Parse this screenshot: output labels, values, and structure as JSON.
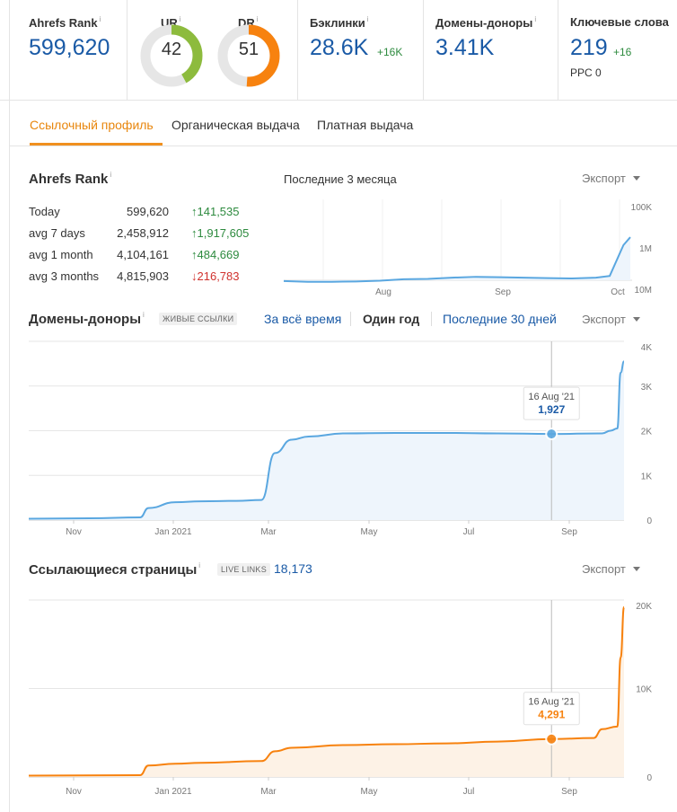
{
  "metrics": {
    "ahrefs_rank": {
      "label": "Ahrefs Rank",
      "value": "599,620"
    },
    "ur": {
      "label": "UR",
      "value": "42",
      "score": 42,
      "color": "#8dbb3d"
    },
    "dr": {
      "label": "DR",
      "value": "51",
      "score": 51,
      "color": "#f7820f"
    },
    "backlinks": {
      "label": "Бэклинки",
      "value": "28.6K",
      "delta": "+16K"
    },
    "ref_domains": {
      "label": "Домены-доноры",
      "value": "3.41K"
    },
    "keywords": {
      "label": "Ключевые слова",
      "value": "219",
      "delta": "+16",
      "sub": "PPC 0"
    }
  },
  "info_mark": "i",
  "tabs": [
    {
      "label": "Ссылочный профиль",
      "active": true
    },
    {
      "label": "Органическая выдача",
      "active": false
    },
    {
      "label": "Платная выдача",
      "active": false
    }
  ],
  "rank_section": {
    "title": "Ahrefs Rank",
    "period_label": "Последние 3 месяца",
    "export_label": "Экспорт",
    "rows": [
      {
        "label": "Today",
        "value": "599,620",
        "change": "141,535",
        "direction": "up"
      },
      {
        "label": "avg 7 days",
        "value": "2,458,912",
        "change": "1,917,605",
        "direction": "up"
      },
      {
        "label": "avg 1 month",
        "value": "4,104,161",
        "change": "484,669",
        "direction": "up"
      },
      {
        "label": "avg 3 months",
        "value": "4,815,903",
        "change": "216,783",
        "direction": "down"
      }
    ]
  },
  "ref_domains_section": {
    "title": "Домены-доноры",
    "badge": "ЖИВЫЕ ССЫЛКИ",
    "ranges": [
      {
        "label": "За всё время",
        "active": false
      },
      {
        "label": "Один год",
        "active": true
      },
      {
        "label": "Последние 30 дней",
        "active": false
      }
    ],
    "export_label": "Экспорт"
  },
  "ref_pages_section": {
    "title": "Ссылающиеся страницы",
    "badge": "LIVE LINKS",
    "count": "18,173",
    "export_label": "Экспорт"
  },
  "chart_data": [
    {
      "type": "area",
      "name": "rank",
      "color": "#5aa7e0",
      "x_ticks": [
        "Aug",
        "Sep",
        "Oct"
      ],
      "y_ticks": [
        "100K",
        "1M",
        "10M"
      ],
      "y_scale": "log-reversed",
      "x": [
        "2021-07-01",
        "2021-07-08",
        "2021-07-15",
        "2021-07-22",
        "2021-07-29",
        "2021-08-05",
        "2021-08-12",
        "2021-08-19",
        "2021-08-26",
        "2021-09-02",
        "2021-09-09",
        "2021-09-16",
        "2021-09-23",
        "2021-09-30",
        "2021-10-04",
        "2021-10-08",
        "2021-10-10"
      ],
      "values": [
        5200000,
        5400000,
        5400000,
        5300000,
        5100000,
        4700000,
        4600000,
        4300000,
        4100000,
        4200000,
        4300000,
        4400000,
        4500000,
        4300000,
        3900000,
        700000,
        450000
      ]
    },
    {
      "type": "area",
      "name": "ref_domains",
      "color": "#5aa7e0",
      "fill": "#eef5fc",
      "x_ticks": [
        "Nov",
        "Jan 2021",
        "Mar",
        "May",
        "Jul",
        "Sep"
      ],
      "y_ticks": [
        "4K",
        "3K",
        "2K",
        "1K",
        "0"
      ],
      "ylim": [
        0,
        4000
      ],
      "x": [
        "2020-10-10",
        "2020-11-15",
        "2020-12-15",
        "2020-12-20",
        "2021-01-05",
        "2021-01-20",
        "2021-02-10",
        "2021-02-25",
        "2021-03-05",
        "2021-03-15",
        "2021-03-25",
        "2021-04-15",
        "2021-05-15",
        "2021-06-15",
        "2021-07-15",
        "2021-08-16",
        "2021-09-15",
        "2021-09-20",
        "2021-09-24",
        "2021-09-26",
        "2021-09-28"
      ],
      "values": [
        30,
        40,
        60,
        270,
        400,
        420,
        430,
        450,
        1500,
        1800,
        1870,
        1940,
        1950,
        1950,
        1940,
        1927,
        1940,
        2000,
        2050,
        3300,
        3550
      ],
      "tooltip": {
        "date": "16 Aug '21",
        "value": "1,927",
        "x": "2021-08-16",
        "y": 1927
      }
    },
    {
      "type": "area",
      "name": "ref_pages",
      "color": "#f7820f",
      "fill": "#fdf2e6",
      "x_ticks": [
        "Nov",
        "Jan 2021",
        "Mar",
        "May",
        "Jul",
        "Sep"
      ],
      "y_ticks": [
        "20K",
        "10K",
        "0"
      ],
      "ylim": [
        0,
        20000
      ],
      "x": [
        "2020-10-10",
        "2020-12-15",
        "2020-12-20",
        "2021-01-05",
        "2021-01-20",
        "2021-02-25",
        "2021-03-05",
        "2021-03-15",
        "2021-04-15",
        "2021-05-15",
        "2021-06-15",
        "2021-07-15",
        "2021-08-16",
        "2021-09-10",
        "2021-09-15",
        "2021-09-24",
        "2021-09-26",
        "2021-09-28"
      ],
      "values": [
        150,
        200,
        1300,
        1500,
        1600,
        1800,
        2900,
        3300,
        3600,
        3700,
        3800,
        4000,
        4291,
        4400,
        5400,
        5700,
        13500,
        19200
      ],
      "tooltip": {
        "date": "16 Aug '21",
        "value": "4,291",
        "x": "2021-08-16",
        "y": 4291
      }
    }
  ]
}
